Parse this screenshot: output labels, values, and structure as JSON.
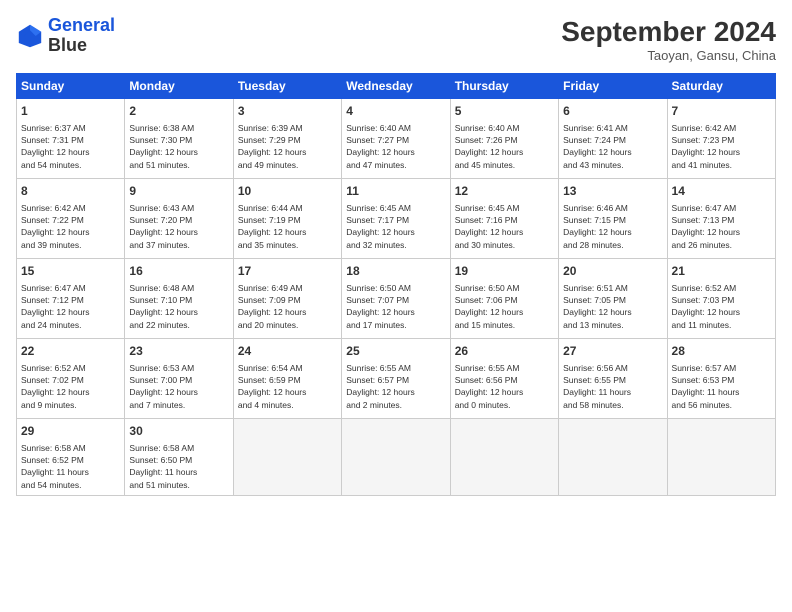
{
  "header": {
    "logo_line1": "General",
    "logo_line2": "Blue",
    "month": "September 2024",
    "location": "Taoyan, Gansu, China"
  },
  "weekdays": [
    "Sunday",
    "Monday",
    "Tuesday",
    "Wednesday",
    "Thursday",
    "Friday",
    "Saturday"
  ],
  "weeks": [
    [
      {
        "day": "1",
        "info": "Sunrise: 6:37 AM\nSunset: 7:31 PM\nDaylight: 12 hours\nand 54 minutes."
      },
      {
        "day": "2",
        "info": "Sunrise: 6:38 AM\nSunset: 7:30 PM\nDaylight: 12 hours\nand 51 minutes."
      },
      {
        "day": "3",
        "info": "Sunrise: 6:39 AM\nSunset: 7:29 PM\nDaylight: 12 hours\nand 49 minutes."
      },
      {
        "day": "4",
        "info": "Sunrise: 6:40 AM\nSunset: 7:27 PM\nDaylight: 12 hours\nand 47 minutes."
      },
      {
        "day": "5",
        "info": "Sunrise: 6:40 AM\nSunset: 7:26 PM\nDaylight: 12 hours\nand 45 minutes."
      },
      {
        "day": "6",
        "info": "Sunrise: 6:41 AM\nSunset: 7:24 PM\nDaylight: 12 hours\nand 43 minutes."
      },
      {
        "day": "7",
        "info": "Sunrise: 6:42 AM\nSunset: 7:23 PM\nDaylight: 12 hours\nand 41 minutes."
      }
    ],
    [
      {
        "day": "8",
        "info": "Sunrise: 6:42 AM\nSunset: 7:22 PM\nDaylight: 12 hours\nand 39 minutes."
      },
      {
        "day": "9",
        "info": "Sunrise: 6:43 AM\nSunset: 7:20 PM\nDaylight: 12 hours\nand 37 minutes."
      },
      {
        "day": "10",
        "info": "Sunrise: 6:44 AM\nSunset: 7:19 PM\nDaylight: 12 hours\nand 35 minutes."
      },
      {
        "day": "11",
        "info": "Sunrise: 6:45 AM\nSunset: 7:17 PM\nDaylight: 12 hours\nand 32 minutes."
      },
      {
        "day": "12",
        "info": "Sunrise: 6:45 AM\nSunset: 7:16 PM\nDaylight: 12 hours\nand 30 minutes."
      },
      {
        "day": "13",
        "info": "Sunrise: 6:46 AM\nSunset: 7:15 PM\nDaylight: 12 hours\nand 28 minutes."
      },
      {
        "day": "14",
        "info": "Sunrise: 6:47 AM\nSunset: 7:13 PM\nDaylight: 12 hours\nand 26 minutes."
      }
    ],
    [
      {
        "day": "15",
        "info": "Sunrise: 6:47 AM\nSunset: 7:12 PM\nDaylight: 12 hours\nand 24 minutes."
      },
      {
        "day": "16",
        "info": "Sunrise: 6:48 AM\nSunset: 7:10 PM\nDaylight: 12 hours\nand 22 minutes."
      },
      {
        "day": "17",
        "info": "Sunrise: 6:49 AM\nSunset: 7:09 PM\nDaylight: 12 hours\nand 20 minutes."
      },
      {
        "day": "18",
        "info": "Sunrise: 6:50 AM\nSunset: 7:07 PM\nDaylight: 12 hours\nand 17 minutes."
      },
      {
        "day": "19",
        "info": "Sunrise: 6:50 AM\nSunset: 7:06 PM\nDaylight: 12 hours\nand 15 minutes."
      },
      {
        "day": "20",
        "info": "Sunrise: 6:51 AM\nSunset: 7:05 PM\nDaylight: 12 hours\nand 13 minutes."
      },
      {
        "day": "21",
        "info": "Sunrise: 6:52 AM\nSunset: 7:03 PM\nDaylight: 12 hours\nand 11 minutes."
      }
    ],
    [
      {
        "day": "22",
        "info": "Sunrise: 6:52 AM\nSunset: 7:02 PM\nDaylight: 12 hours\nand 9 minutes."
      },
      {
        "day": "23",
        "info": "Sunrise: 6:53 AM\nSunset: 7:00 PM\nDaylight: 12 hours\nand 7 minutes."
      },
      {
        "day": "24",
        "info": "Sunrise: 6:54 AM\nSunset: 6:59 PM\nDaylight: 12 hours\nand 4 minutes."
      },
      {
        "day": "25",
        "info": "Sunrise: 6:55 AM\nSunset: 6:57 PM\nDaylight: 12 hours\nand 2 minutes."
      },
      {
        "day": "26",
        "info": "Sunrise: 6:55 AM\nSunset: 6:56 PM\nDaylight: 12 hours\nand 0 minutes."
      },
      {
        "day": "27",
        "info": "Sunrise: 6:56 AM\nSunset: 6:55 PM\nDaylight: 11 hours\nand 58 minutes."
      },
      {
        "day": "28",
        "info": "Sunrise: 6:57 AM\nSunset: 6:53 PM\nDaylight: 11 hours\nand 56 minutes."
      }
    ],
    [
      {
        "day": "29",
        "info": "Sunrise: 6:58 AM\nSunset: 6:52 PM\nDaylight: 11 hours\nand 54 minutes."
      },
      {
        "day": "30",
        "info": "Sunrise: 6:58 AM\nSunset: 6:50 PM\nDaylight: 11 hours\nand 51 minutes."
      },
      {
        "day": "",
        "info": ""
      },
      {
        "day": "",
        "info": ""
      },
      {
        "day": "",
        "info": ""
      },
      {
        "day": "",
        "info": ""
      },
      {
        "day": "",
        "info": ""
      }
    ]
  ]
}
